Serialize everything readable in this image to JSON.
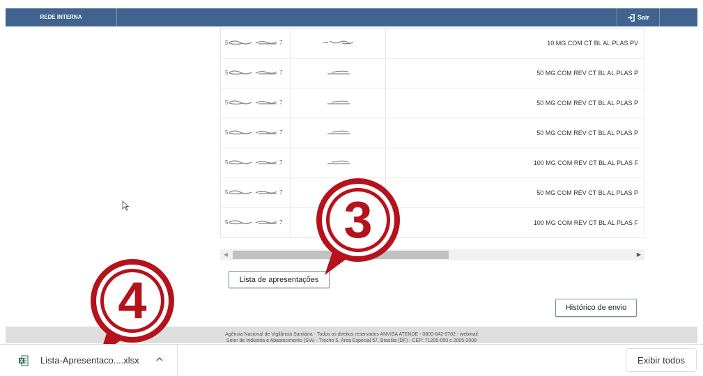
{
  "header": {
    "rede_label": "REDE INTERNA",
    "sair_label": "Sair"
  },
  "table": {
    "rows": [
      {
        "col3": "10 MG COM CT BL AL PLAS PV"
      },
      {
        "col3": "50 MG COM REV CT BL AL PLAS P"
      },
      {
        "col3": "50 MG COM REV CT BL AL PLAS P"
      },
      {
        "col3": "50 MG COM REV CT BL AL PLAS P"
      },
      {
        "col3": "100 MG COM REV CT BL AL PLAS F"
      },
      {
        "col3": "50 MG COM REV CT BL AL PLAS P"
      },
      {
        "col3": "100 MG COM REV CT BL AL PLAS F"
      }
    ]
  },
  "buttons": {
    "lista": "Lista de apresentações",
    "historico": "Histórico de envio"
  },
  "footer": {
    "line1": "Agência Nacional de Vigilância Sanitária - Todos os direitos reservados  ANVISA ATENDE - 0800-642-9782 - webmail",
    "line2": "Setor de Indústria e Abastecimento (SIA) - Trecho 5, Área Especial 57, Brasília (DF) - CEP: 71205-050 c 2005-2009"
  },
  "downloads": {
    "file_name": "Lista-Apresentaco....xlsx",
    "show_all": "Exibir todos"
  },
  "callouts": {
    "step3": "3",
    "step4": "4"
  },
  "colors": {
    "header_bg": "#40638f",
    "callout_red": "#b5121b"
  }
}
